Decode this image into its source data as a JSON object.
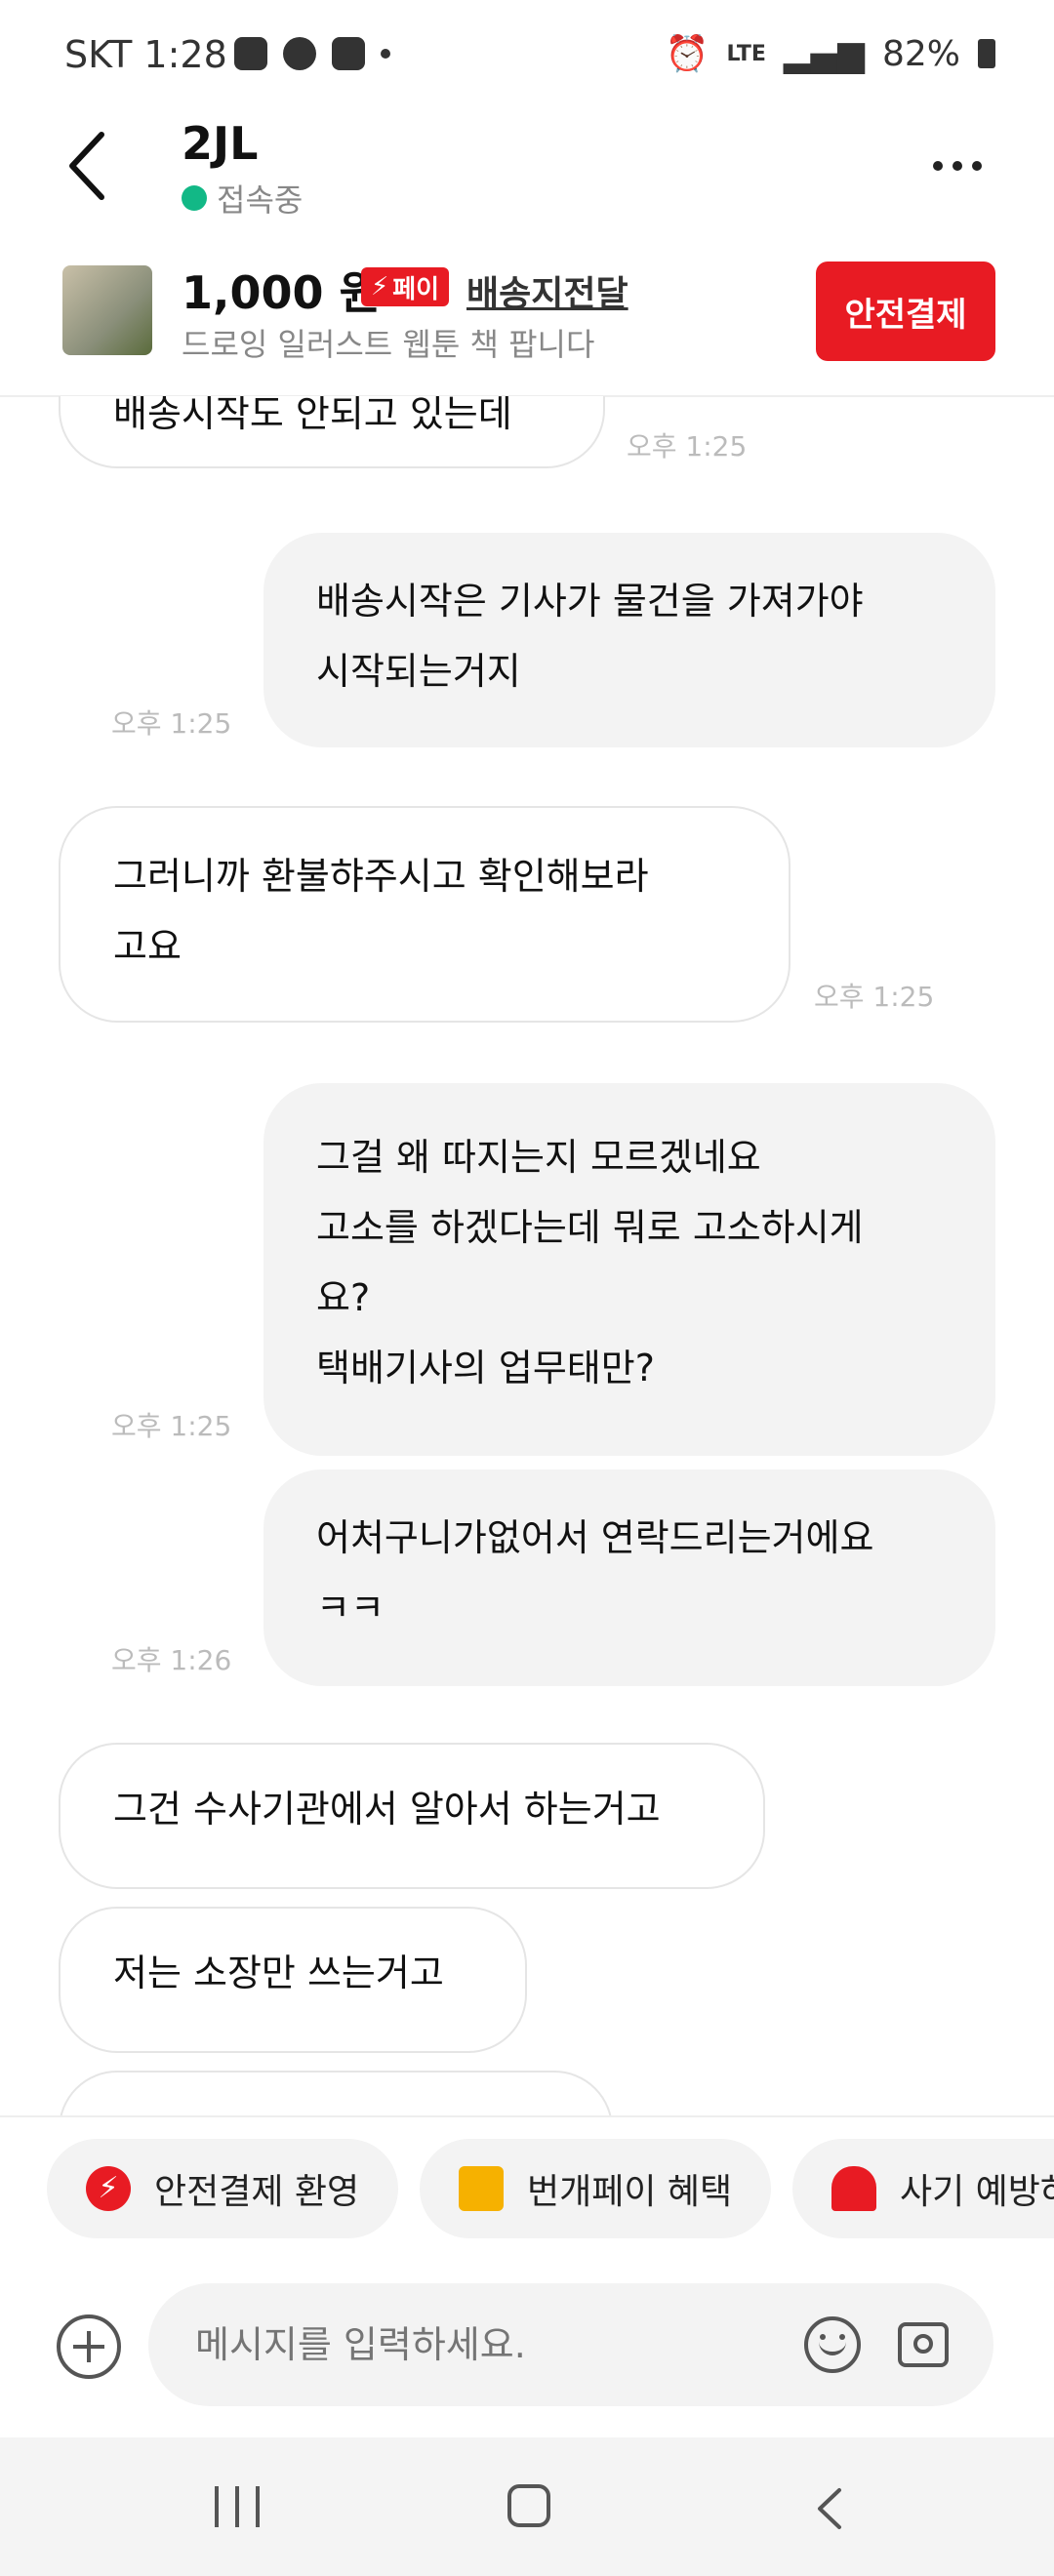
{
  "status_bar": {
    "carrier": "SKT",
    "time": "1:28",
    "network": "LTE",
    "battery": "82%"
  },
  "header": {
    "title": "2JL",
    "presence": "접속중"
  },
  "product": {
    "price": "1,000 원",
    "pay_badge": "페이",
    "shipping": "배송지전달",
    "description": "드로잉 일러스트 웹툰 책 팝니다",
    "safe_pay_button": "안전결제"
  },
  "messages": [
    {
      "dir": "in",
      "lines": [
        "배송시작도 안되고 있는데"
      ],
      "time": "오후 1:25"
    },
    {
      "dir": "out",
      "lines": [
        "배송시작은 기사가 물건을 가져가야",
        "시작되는거지"
      ],
      "time": "오후 1:25"
    },
    {
      "dir": "in",
      "lines": [
        "그러니까 환불햐주시고 확인해보라",
        "고요"
      ],
      "time": "오후 1:25"
    },
    {
      "dir": "out",
      "lines": [
        "그걸 왜 따지는지 모르겠네요",
        "고소를 하겠다는데 뭐로 고소하시게",
        "요?",
        "택배기사의 업무태만?"
      ],
      "time": "오후 1:25"
    },
    {
      "dir": "out",
      "lines": [
        "어처구니가없어서 연락드리는거에요",
        "ㅋㅋ"
      ],
      "time": "오후 1:26"
    },
    {
      "dir": "in",
      "lines": [
        "그건 수사기관에서 알아서 하는거고"
      ],
      "time": ""
    },
    {
      "dir": "in",
      "lines": [
        "저는 소장만 쓰는거고"
      ],
      "time": ""
    }
  ],
  "quick_actions": [
    {
      "label": "안전결제 환영",
      "icon": "lightning-icon"
    },
    {
      "label": "번개페이 혜택",
      "icon": "gift-icon"
    },
    {
      "label": "사기 예방하",
      "icon": "siren-icon"
    }
  ],
  "input": {
    "placeholder": "메시지를 입력하세요."
  },
  "colors": {
    "accent": "#e81b23",
    "online": "#12b886"
  }
}
